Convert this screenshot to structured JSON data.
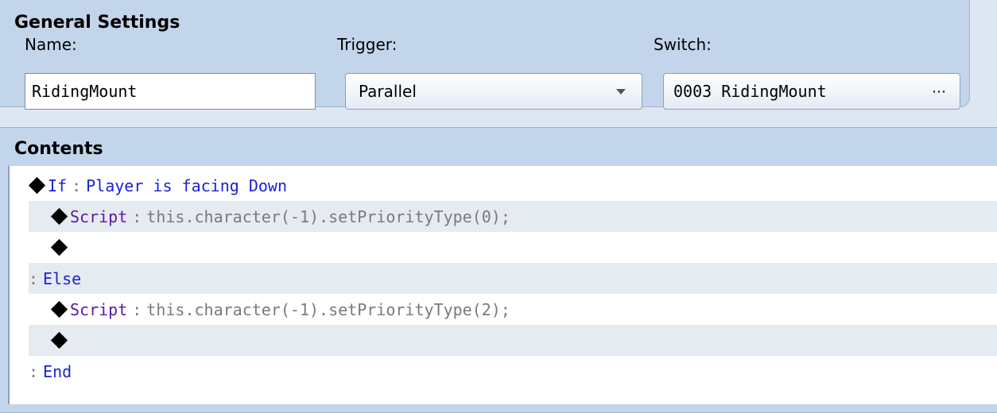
{
  "general_settings": {
    "title": "General Settings",
    "name_label": "Name:",
    "name_value": "RidingMount",
    "trigger_label": "Trigger:",
    "trigger_value": "Parallel",
    "switch_label": "Switch:",
    "switch_value": "0003 RidingMount",
    "switch_button": "⋯"
  },
  "contents": {
    "title": "Contents",
    "separator": ":",
    "rows": [
      {
        "command": "If",
        "argument": "Player is facing Down"
      },
      {
        "command": "Script",
        "argument": "this.character(-1).setPriorityType(0);"
      },
      {
        "command": "",
        "argument": ""
      },
      {
        "command": "Else",
        "argument": ""
      },
      {
        "command": "Script",
        "argument": "this.character(-1).setPriorityType(2);"
      },
      {
        "command": "",
        "argument": ""
      },
      {
        "command": "End",
        "argument": ""
      }
    ]
  },
  "colors": {
    "panel_bg": "#c3d5ea",
    "command_blue": "#1a22d8",
    "command_purple": "#5b1aa0",
    "argument_gray": "#7a7a7a"
  }
}
